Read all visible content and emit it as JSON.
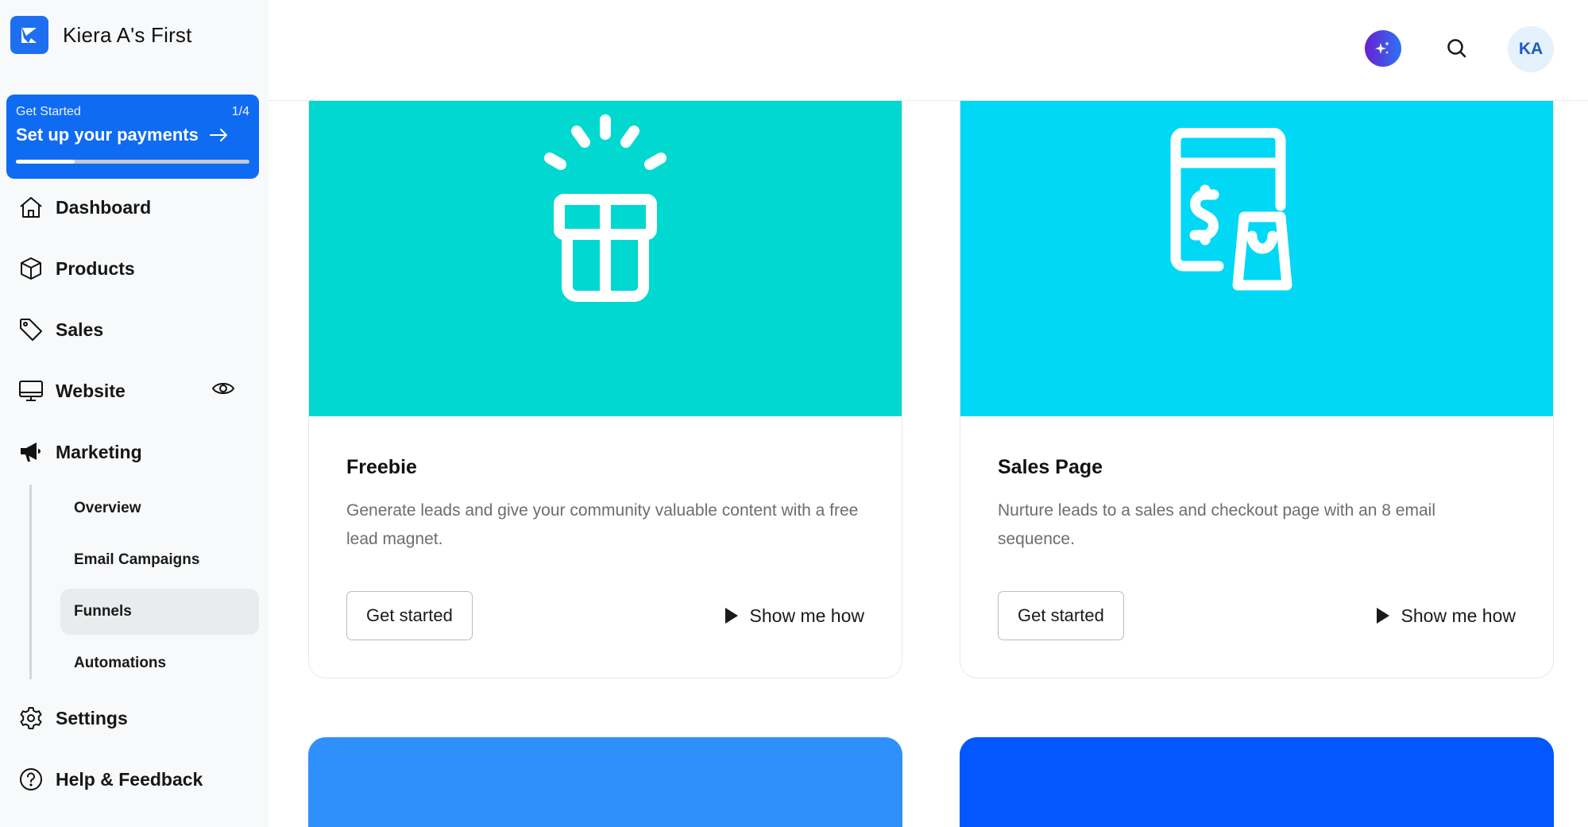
{
  "brand": {
    "name": "Kiera A's First",
    "logo_icon": "kajabi-logo-icon"
  },
  "onboarding": {
    "eyebrow": "Get Started",
    "step": "1/4",
    "title": "Set up your payments",
    "arrow_icon": "arrow-right-icon",
    "progress_fraction": 0.25
  },
  "sidebar": {
    "items": [
      {
        "label": "Dashboard",
        "icon": "home-icon"
      },
      {
        "label": "Products",
        "icon": "box-icon"
      },
      {
        "label": "Sales",
        "icon": "tag-icon"
      },
      {
        "label": "Website",
        "icon": "monitor-icon",
        "trailing_icon": "eye-icon"
      },
      {
        "label": "Marketing",
        "icon": "megaphone-icon"
      },
      {
        "label": "Settings",
        "icon": "gear-icon"
      },
      {
        "label": "Help & Feedback",
        "icon": "help-circle-icon"
      }
    ],
    "marketing_subitems": [
      {
        "label": "Overview",
        "active": false
      },
      {
        "label": "Email Campaigns",
        "active": false
      },
      {
        "label": "Funnels",
        "active": true
      },
      {
        "label": "Automations",
        "active": false
      }
    ]
  },
  "header": {
    "ai_button_icon": "sparkles-icon",
    "search_icon": "search-icon",
    "avatar_initials": "KA"
  },
  "cards": [
    {
      "title": "Freebie",
      "description": "Generate leads and give your community valuable content with a free lead magnet.",
      "hero_color": "#00d8d0",
      "hero_icon": "gift-icon",
      "primary_button": "Get started",
      "secondary_link": "Show me how"
    },
    {
      "title": "Sales Page",
      "description": "Nurture leads to a sales and checkout page with an 8 email sequence.",
      "hero_color": "#00d8f5",
      "hero_icon": "sales-page-bag-icon",
      "primary_button": "Get started",
      "secondary_link": "Show me how"
    }
  ],
  "partial_cards": [
    {
      "hero_color": "#2f90fb"
    },
    {
      "hero_color": "#0257fe"
    }
  ]
}
